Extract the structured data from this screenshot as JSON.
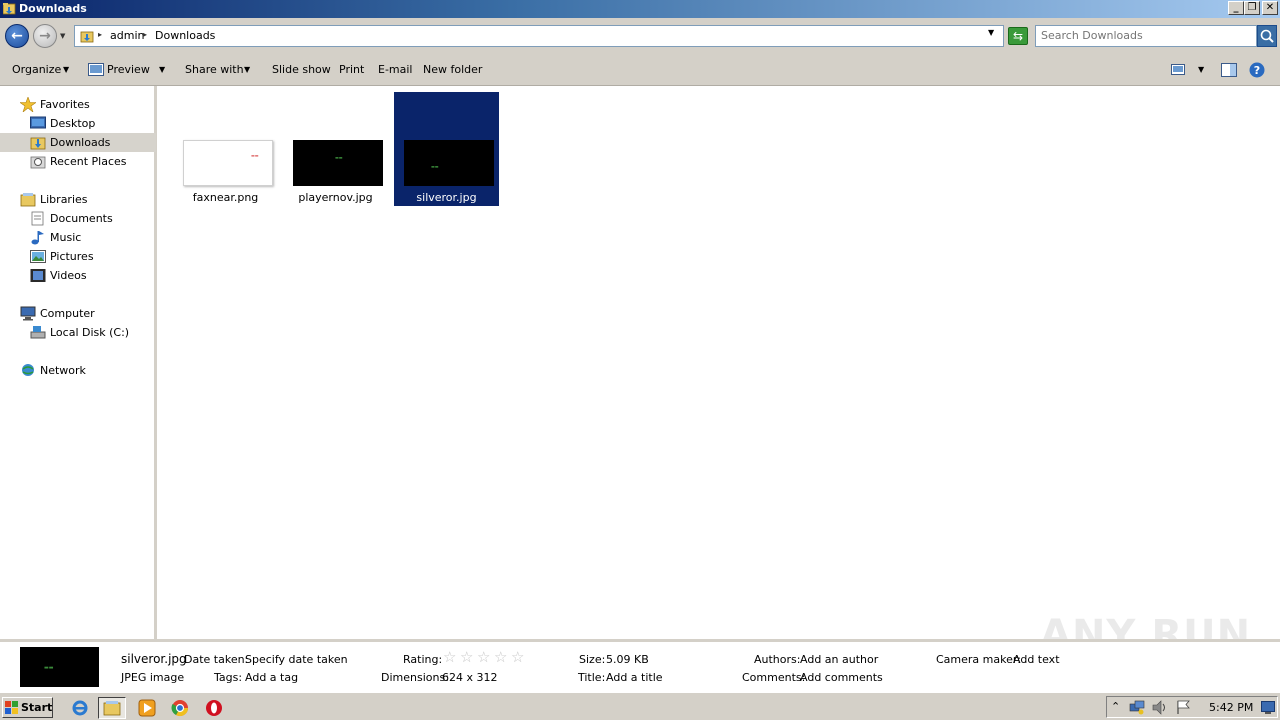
{
  "window": {
    "title": "Downloads",
    "buttons": {
      "minimize": "_",
      "restore": "❐",
      "close": "✕"
    }
  },
  "address": {
    "breadcrumbs": [
      "admin",
      "Downloads"
    ],
    "search_placeholder": "Search Downloads"
  },
  "toolbar": {
    "organize": "Organize",
    "preview": "Preview",
    "share_with": "Share with",
    "slide_show": "Slide show",
    "print": "Print",
    "email": "E-mail",
    "new_folder": "New folder"
  },
  "nav": {
    "favorites": "Favorites",
    "desktop": "Desktop",
    "downloads": "Downloads",
    "recent_places": "Recent Places",
    "libraries": "Libraries",
    "documents": "Documents",
    "music": "Music",
    "pictures": "Pictures",
    "videos": "Videos",
    "computer": "Computer",
    "local_disk": "Local Disk (C:)",
    "network": "Network"
  },
  "files": [
    {
      "name": "faxnear.png",
      "thumb_bg": "#ffffff",
      "selected": false
    },
    {
      "name": "playernov.jpg",
      "thumb_bg": "#000000",
      "selected": false
    },
    {
      "name": "silveror.jpg",
      "thumb_bg": "#000000",
      "selected": true
    }
  ],
  "details": {
    "file_name": "silveror.jpg",
    "file_type": "JPEG image",
    "date_taken_label": "Date taken:",
    "date_taken_value": "Specify date taken",
    "tags_label": "Tags:",
    "tags_value": "Add a tag",
    "rating_label": "Rating:",
    "rating_value": 0,
    "dimensions_label": "Dimensions:",
    "dimensions_value": "624 x 312",
    "size_label": "Size:",
    "size_value": "5.09 KB",
    "title_label": "Title:",
    "title_value": "Add a title",
    "authors_label": "Authors:",
    "authors_value": "Add an author",
    "comments_label": "Comments:",
    "comments_value": "Add comments",
    "camera_label": "Camera maker:",
    "camera_value": "Add text"
  },
  "watermark": "ANY RUN",
  "taskbar": {
    "start": "Start",
    "clock": "5:42 PM"
  },
  "colors": {
    "selection": "#0a246a",
    "chrome": "#d4d0c8",
    "title_gradient_start": "#0a246a"
  }
}
